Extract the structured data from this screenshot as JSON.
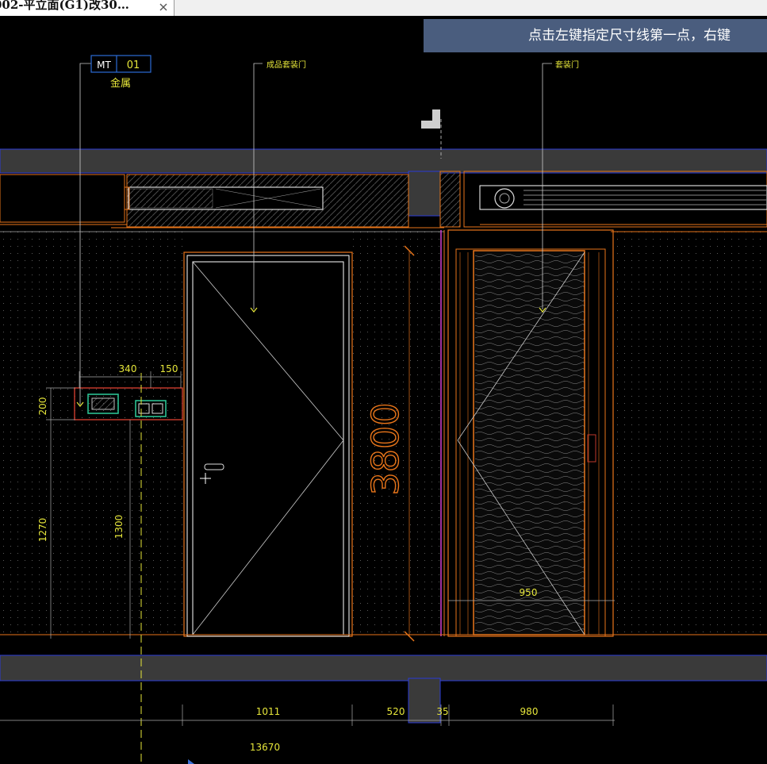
{
  "tab": {
    "title": "002-平立面(G1)改30…"
  },
  "hint": {
    "text": "点击左键指定尺寸线第一点，右键"
  },
  "drawing": {
    "tags": {
      "material_code": "MT",
      "material_number": "01",
      "material_name": "金属",
      "door_label_left": "成品套装门",
      "door_label_right": "套装门"
    },
    "dimensions": {
      "width_340": "340",
      "width_150": "150",
      "height_200": "200",
      "height_1270": "1270",
      "height_1300": "1300",
      "door_height": "3800",
      "door_width_950": "950",
      "bottom_1011": "1011",
      "bottom_520": "520",
      "bottom_35": "35",
      "bottom_980": "980",
      "total_13670": "13670"
    }
  },
  "colors": {
    "background": "#000000",
    "wall_fill": "#3a3a3a",
    "outline_blue": "#2b3bd6",
    "accent_orange": "#e8751a",
    "dimension_yellow": "#e6e63a",
    "tooltip_bg": "#4a5d7e"
  }
}
